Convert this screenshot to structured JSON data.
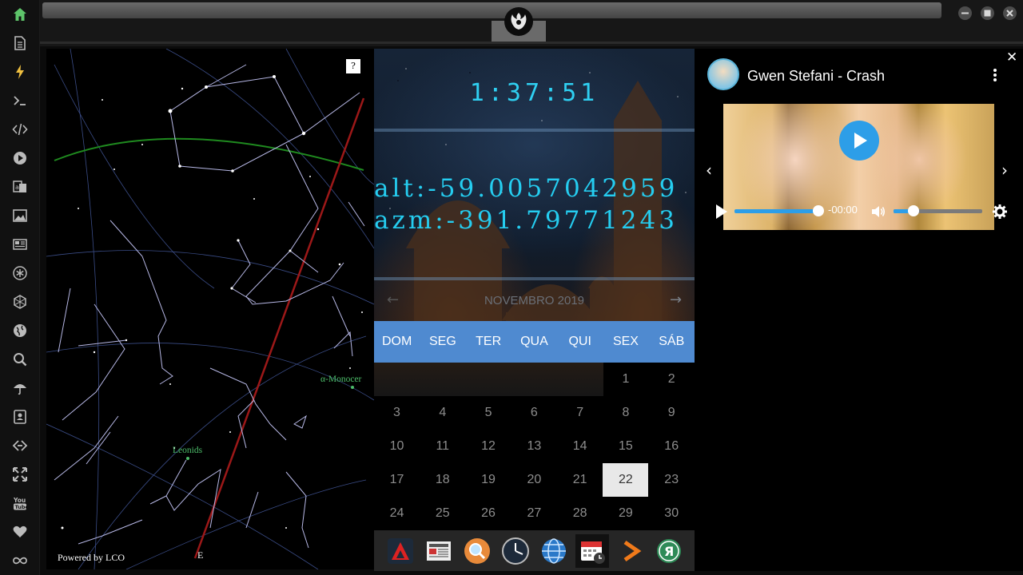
{
  "sidebar": {
    "items": [
      {
        "name": "home-icon"
      },
      {
        "name": "document-icon"
      },
      {
        "name": "lightning-icon"
      },
      {
        "name": "terminal-icon"
      },
      {
        "name": "code-icon"
      },
      {
        "name": "play-circle-icon"
      },
      {
        "name": "translate-icon"
      },
      {
        "name": "image-icon"
      },
      {
        "name": "newspaper-icon"
      },
      {
        "name": "asterisk-icon"
      },
      {
        "name": "hexagon-icon"
      },
      {
        "name": "globe-icon"
      },
      {
        "name": "search-icon"
      },
      {
        "name": "umbrella-icon"
      },
      {
        "name": "contacts-icon"
      },
      {
        "name": "link-icon"
      },
      {
        "name": "expand-icon"
      },
      {
        "name": "youtube-icon"
      },
      {
        "name": "heart-icon"
      },
      {
        "name": "infinity-icon"
      }
    ],
    "accent": "#5ec46a"
  },
  "sky": {
    "help_label": "?",
    "credit": "Powered by LCO",
    "compass_label": "E",
    "labels": [
      "α-Monocer",
      "Leonids"
    ]
  },
  "widget": {
    "clock": "1:37:51",
    "alt": "alt:-59.0057042959",
    "azm": "azm:-391.79771243",
    "month": "NOVEMBRO 2019",
    "weekdays": [
      "DOM",
      "SEG",
      "TER",
      "QUA",
      "QUI",
      "SEX",
      "SÁB"
    ],
    "days": [
      [
        "",
        "",
        "",
        "",
        "",
        "1",
        "2"
      ],
      [
        "3",
        "4",
        "5",
        "6",
        "7",
        "8",
        "9"
      ],
      [
        "10",
        "11",
        "12",
        "13",
        "14",
        "15",
        "16"
      ],
      [
        "17",
        "18",
        "19",
        "20",
        "21",
        "22",
        "23"
      ],
      [
        "24",
        "25",
        "26",
        "27",
        "28",
        "29",
        "30"
      ]
    ],
    "today": "22",
    "accent": "#4f8ad0"
  },
  "dock": {
    "apps": [
      "app-red-triangle-icon",
      "news-app-icon",
      "search-app-icon",
      "clock-app-icon",
      "browser-globe-icon",
      "calendar-app-icon",
      "arrow-app-icon",
      "yandex-app-icon"
    ]
  },
  "player": {
    "title": "Gwen Stefani - Crash",
    "time": "-00:00",
    "progress": 1.0,
    "volume": 0.2,
    "accent": "#2d9ee8"
  }
}
